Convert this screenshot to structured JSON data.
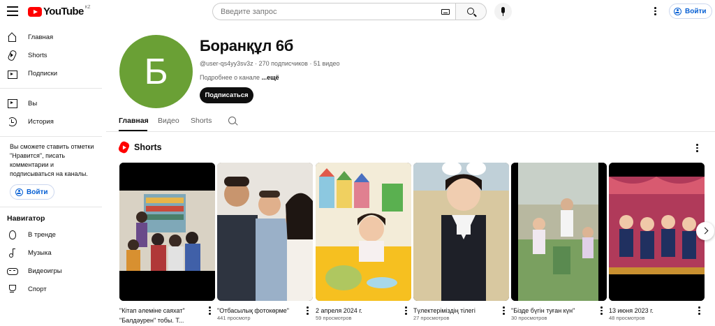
{
  "header": {
    "logo_text": "YouTube",
    "region": "KZ",
    "search_placeholder": "Введите запрос",
    "signin_label": "Войти"
  },
  "sidebar": {
    "main": [
      {
        "label": "Главная",
        "icon": "home-icon"
      },
      {
        "label": "Shorts",
        "icon": "shorts-icon"
      },
      {
        "label": "Подписки",
        "icon": "subscriptions-icon"
      }
    ],
    "you": [
      {
        "label": "Вы",
        "icon": "you-icon"
      },
      {
        "label": "История",
        "icon": "history-icon"
      }
    ],
    "signin_message": "Вы сможете ставить отметки \"Нравится\", писать комментарии и подписываться на каналы.",
    "signin_label": "Войти",
    "navigator_title": "Навигатор",
    "navigator": [
      {
        "label": "В тренде",
        "icon": "trending-icon"
      },
      {
        "label": "Музыка",
        "icon": "music-icon"
      },
      {
        "label": "Видеоигры",
        "icon": "gaming-icon"
      },
      {
        "label": "Спорт",
        "icon": "sports-icon"
      }
    ]
  },
  "channel": {
    "avatar_letter": "Б",
    "avatar_color": "#6aa035",
    "name": "Боранқұл 6б",
    "meta": "@user-qs4yy3sv3z · 270 подписчиков · 51 видео",
    "about_prefix": "Подробнее о канале ",
    "about_more": "...ещё",
    "subscribe_label": "Подписаться"
  },
  "tabs": [
    "Главная",
    "Видео",
    "Shorts"
  ],
  "shelf": {
    "title": "Shorts",
    "items": [
      {
        "title": "\"Кітап әлеміне саяхат\" \"Балдәурен\" тобы. Т...",
        "views": "",
        "theme": "library"
      },
      {
        "title": "\"Отбасылық фотокөрме\"",
        "views": "441 просмотр",
        "theme": "family"
      },
      {
        "title": "2 апреля 2024 г.",
        "views": "59 просмотров",
        "theme": "classroom"
      },
      {
        "title": "Түлектерімiздiң тілегі",
        "views": "27 просмотров",
        "theme": "graduate"
      },
      {
        "title": "\"Бізде бүгін туған күн\"",
        "views": "30 просмотров",
        "theme": "outdoor"
      },
      {
        "title": "13 июня 2023 г.",
        "views": "48 просмотров",
        "theme": "stage"
      }
    ]
  },
  "colors": {
    "accent": "#065fd4",
    "brand": "#ff0000",
    "text": "#0f0f0f",
    "secondary_text": "#606060"
  }
}
